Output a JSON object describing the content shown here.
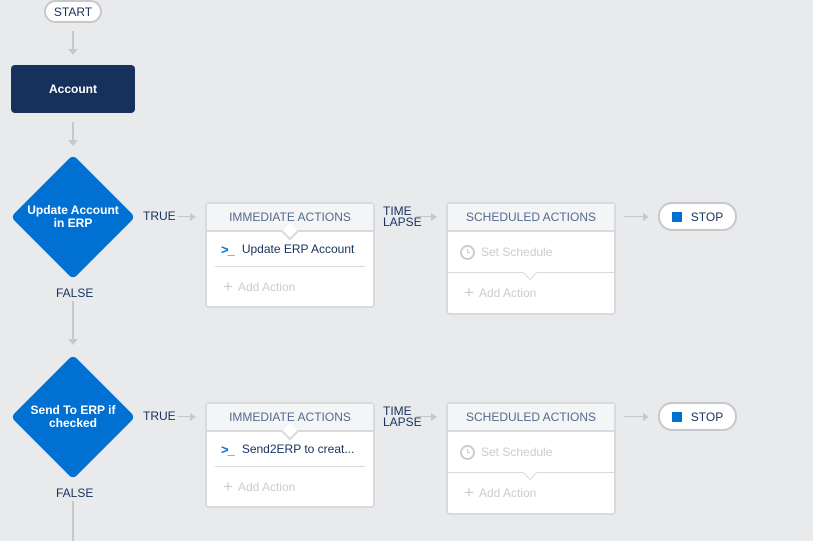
{
  "flow": {
    "start_label": "START",
    "object_label": "Account",
    "true_label": "TRUE",
    "false_label": "FALSE",
    "time_lapse": [
      "TIME",
      "LAPSE"
    ],
    "stop_label": "STOP"
  },
  "criteria": [
    {
      "name": "Update Account in ERP",
      "immediate_header": "IMMEDIATE ACTIONS",
      "immediate_actions": [
        {
          "icon": "apex-prompt-icon",
          "label": "Update ERP Account"
        }
      ],
      "add_action": "Add Action",
      "scheduled_header": "SCHEDULED ACTIONS",
      "set_schedule": "Set Schedule",
      "scheduled_add_action": "Add Action"
    },
    {
      "name": "Send To ERP if checked",
      "immediate_header": "IMMEDIATE ACTIONS",
      "immediate_actions": [
        {
          "icon": "apex-prompt-icon",
          "label": "Send2ERP to creat..."
        }
      ],
      "add_action": "Add Action",
      "scheduled_header": "SCHEDULED ACTIONS",
      "set_schedule": "Set Schedule",
      "scheduled_add_action": "Add Action"
    }
  ],
  "icons": {
    "prompt": ">_",
    "plus": "+"
  },
  "colors": {
    "background": "#e9eaec",
    "object_node": "#16325c",
    "criteria_node": "#0070d2",
    "text": "#16325c",
    "connector": "#c6c8cc",
    "disabled_text": "#c9ccd1"
  }
}
